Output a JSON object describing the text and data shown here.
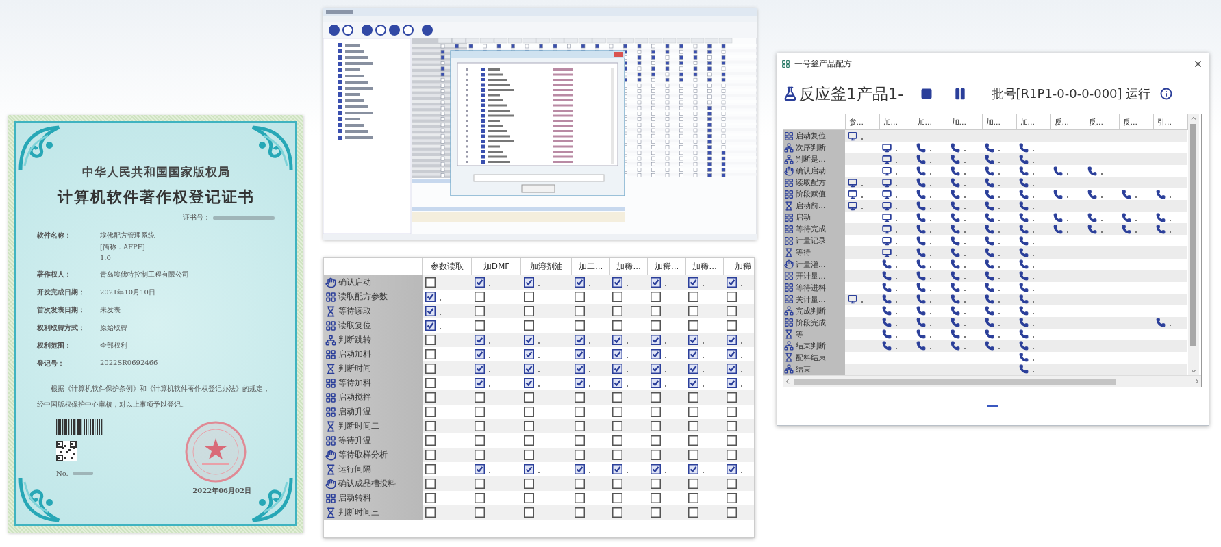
{
  "certificate": {
    "issuer": "中华人民共和国国家版权局",
    "title": "计算机软件著作权登记证书",
    "certificate_no_label": "证书号：",
    "fields": [
      {
        "label": "软件名称：",
        "lines": [
          "埃佛配方管理系统",
          "[简称：AFPF]",
          "1.0"
        ]
      },
      {
        "label": "著作权人：",
        "lines": [
          "青岛埃佛特控制工程有限公司"
        ]
      },
      {
        "label": "开发完成日期：",
        "lines": [
          "2021年10月10日"
        ]
      },
      {
        "label": "首次发表日期：",
        "lines": [
          "未发表"
        ]
      },
      {
        "label": "权利取得方式：",
        "lines": [
          "原始取得"
        ]
      },
      {
        "label": "权利范围：",
        "lines": [
          "全部权利"
        ]
      },
      {
        "label": "登记号：",
        "lines": [
          "2022SR0692466"
        ]
      }
    ],
    "statement": "根据《计算机软件保护条例》和《计算机软件著作权登记办法》的规定，经中国版权保护中心审核，对以上事项予以登记。",
    "serial_label": "No.",
    "date": "2022年06月02日"
  },
  "step_table": {
    "columns": [
      "参数读取",
      "加DMF",
      "加溶剂油",
      "加二...",
      "加稀...",
      "加稀...",
      "加稀...",
      "加稀"
    ],
    "rows": [
      {
        "label": "确认启动",
        "kind": "confirm",
        "cells": [
          {
            "checked": false
          },
          {
            "checked": true
          },
          {
            "checked": true
          },
          {
            "checked": true
          },
          {
            "checked": true
          },
          {
            "checked": true
          },
          {
            "checked": true
          },
          {
            "checked": true
          }
        ]
      },
      {
        "label": "读取配方参数",
        "kind": "action",
        "cells": [
          {
            "checked": true
          },
          {
            "checked": false
          },
          {
            "checked": false
          },
          {
            "checked": false
          },
          {
            "checked": false
          },
          {
            "checked": false
          },
          {
            "checked": false
          },
          {
            "checked": false
          }
        ]
      },
      {
        "label": "等待读取",
        "kind": "wait",
        "cells": [
          {
            "checked": true
          },
          {
            "checked": false
          },
          {
            "checked": false
          },
          {
            "checked": false
          },
          {
            "checked": false
          },
          {
            "checked": false
          },
          {
            "checked": false
          },
          {
            "checked": false
          }
        ]
      },
      {
        "label": "读取复位",
        "kind": "action",
        "cells": [
          {
            "checked": true
          },
          {
            "checked": false
          },
          {
            "checked": false
          },
          {
            "checked": false
          },
          {
            "checked": false
          },
          {
            "checked": false
          },
          {
            "checked": false
          },
          {
            "checked": false
          }
        ]
      },
      {
        "label": "判断跳转",
        "kind": "branch",
        "cells": [
          {
            "checked": false
          },
          {
            "checked": true
          },
          {
            "checked": true
          },
          {
            "checked": true
          },
          {
            "checked": true
          },
          {
            "checked": true
          },
          {
            "checked": true
          },
          {
            "checked": true
          }
        ]
      },
      {
        "label": "启动加料",
        "kind": "action",
        "cells": [
          {
            "checked": false
          },
          {
            "checked": true
          },
          {
            "checked": true
          },
          {
            "checked": true
          },
          {
            "checked": true
          },
          {
            "checked": true
          },
          {
            "checked": true
          },
          {
            "checked": true
          }
        ]
      },
      {
        "label": "判断时间",
        "kind": "wait",
        "cells": [
          {
            "checked": false
          },
          {
            "checked": true
          },
          {
            "checked": true
          },
          {
            "checked": true
          },
          {
            "checked": true
          },
          {
            "checked": true
          },
          {
            "checked": true
          },
          {
            "checked": true
          }
        ]
      },
      {
        "label": "等待加料",
        "kind": "action",
        "cells": [
          {
            "checked": false
          },
          {
            "checked": true
          },
          {
            "checked": true
          },
          {
            "checked": true
          },
          {
            "checked": true
          },
          {
            "checked": true
          },
          {
            "checked": true
          },
          {
            "checked": true
          }
        ]
      },
      {
        "label": "启动搅拌",
        "kind": "action",
        "cells": [
          {
            "checked": false
          },
          {
            "checked": false
          },
          {
            "checked": false
          },
          {
            "checked": false
          },
          {
            "checked": false
          },
          {
            "checked": false
          },
          {
            "checked": false
          },
          {
            "checked": false
          }
        ]
      },
      {
        "label": "启动升温",
        "kind": "action",
        "cells": [
          {
            "checked": false
          },
          {
            "checked": false
          },
          {
            "checked": false
          },
          {
            "checked": false
          },
          {
            "checked": false
          },
          {
            "checked": false
          },
          {
            "checked": false
          },
          {
            "checked": false
          }
        ]
      },
      {
        "label": "判断时间二",
        "kind": "wait",
        "cells": [
          {
            "checked": false
          },
          {
            "checked": false
          },
          {
            "checked": false
          },
          {
            "checked": false
          },
          {
            "checked": false
          },
          {
            "checked": false
          },
          {
            "checked": false
          },
          {
            "checked": false
          }
        ]
      },
      {
        "label": "等待升温",
        "kind": "action",
        "cells": [
          {
            "checked": false
          },
          {
            "checked": false
          },
          {
            "checked": false
          },
          {
            "checked": false
          },
          {
            "checked": false
          },
          {
            "checked": false
          },
          {
            "checked": false
          },
          {
            "checked": false
          }
        ]
      },
      {
        "label": "等待取样分析",
        "kind": "confirm",
        "cells": [
          {
            "checked": false
          },
          {
            "checked": false
          },
          {
            "checked": false
          },
          {
            "checked": false
          },
          {
            "checked": false
          },
          {
            "checked": false
          },
          {
            "checked": false
          },
          {
            "checked": false
          }
        ]
      },
      {
        "label": "运行间隔",
        "kind": "wait",
        "cells": [
          {
            "checked": false
          },
          {
            "checked": true
          },
          {
            "checked": true
          },
          {
            "checked": true
          },
          {
            "checked": true
          },
          {
            "checked": true
          },
          {
            "checked": true
          },
          {
            "checked": true
          }
        ]
      },
      {
        "label": "确认成品槽投料",
        "kind": "confirm",
        "cells": [
          {
            "checked": false
          },
          {
            "checked": false
          },
          {
            "checked": false
          },
          {
            "checked": false
          },
          {
            "checked": false
          },
          {
            "checked": false
          },
          {
            "checked": false
          },
          {
            "checked": false
          }
        ]
      },
      {
        "label": "启动转料",
        "kind": "action",
        "cells": [
          {
            "checked": false
          },
          {
            "checked": false
          },
          {
            "checked": false
          },
          {
            "checked": false
          },
          {
            "checked": false
          },
          {
            "checked": false
          },
          {
            "checked": false
          },
          {
            "checked": false
          }
        ]
      },
      {
        "label": "判断时间三",
        "kind": "wait",
        "cells": [
          {
            "checked": false
          },
          {
            "checked": false
          },
          {
            "checked": false
          },
          {
            "checked": false
          },
          {
            "checked": false
          },
          {
            "checked": false
          },
          {
            "checked": false
          },
          {
            "checked": false
          }
        ]
      }
    ]
  },
  "recipe_window": {
    "title": "一号釜产品配方",
    "heading": "反应釜1产品1-",
    "batch": "批号[R1P1-0-0-0-000] 运行",
    "columns": [
      "参...",
      "加...",
      "加...",
      "加...",
      "加...",
      "加...",
      "反...",
      "反...",
      "反...",
      "引..."
    ],
    "rows": [
      {
        "label": "启动复位",
        "kind": "action",
        "cells": [
          {
            "kind": "display"
          },
          {
            "kind": "empty"
          },
          {
            "kind": "empty"
          },
          {
            "kind": "empty"
          },
          {
            "kind": "empty"
          },
          {
            "kind": "empty"
          },
          {
            "kind": "empty"
          },
          {
            "kind": "empty"
          },
          {
            "kind": "empty"
          },
          {
            "kind": "empty"
          }
        ]
      },
      {
        "label": "次序判断",
        "kind": "branch",
        "cells": [
          {
            "kind": "empty"
          },
          {
            "kind": "display"
          },
          {
            "kind": "phone"
          },
          {
            "kind": "phone"
          },
          {
            "kind": "phone"
          },
          {
            "kind": "phone"
          },
          {
            "kind": "empty"
          },
          {
            "kind": "empty"
          },
          {
            "kind": "empty"
          },
          {
            "kind": "empty"
          }
        ]
      },
      {
        "label": "判断是...",
        "kind": "branch",
        "cells": [
          {
            "kind": "empty"
          },
          {
            "kind": "display"
          },
          {
            "kind": "phone"
          },
          {
            "kind": "phone"
          },
          {
            "kind": "phone"
          },
          {
            "kind": "phone"
          },
          {
            "kind": "empty"
          },
          {
            "kind": "empty"
          },
          {
            "kind": "empty"
          },
          {
            "kind": "empty"
          }
        ]
      },
      {
        "label": "确认启动",
        "kind": "confirm",
        "cells": [
          {
            "kind": "empty"
          },
          {
            "kind": "display"
          },
          {
            "kind": "phone"
          },
          {
            "kind": "phone"
          },
          {
            "kind": "phone"
          },
          {
            "kind": "phone"
          },
          {
            "kind": "phone"
          },
          {
            "kind": "phone"
          },
          {
            "kind": "empty"
          },
          {
            "kind": "empty"
          }
        ]
      },
      {
        "label": "读取配方",
        "kind": "action",
        "cells": [
          {
            "kind": "display"
          },
          {
            "kind": "display"
          },
          {
            "kind": "phone"
          },
          {
            "kind": "phone"
          },
          {
            "kind": "phone"
          },
          {
            "kind": "phone"
          },
          {
            "kind": "empty"
          },
          {
            "kind": "empty"
          },
          {
            "kind": "empty"
          },
          {
            "kind": "empty"
          }
        ]
      },
      {
        "label": "阶段赋值",
        "kind": "action",
        "cells": [
          {
            "kind": "display"
          },
          {
            "kind": "display"
          },
          {
            "kind": "phone"
          },
          {
            "kind": "phone"
          },
          {
            "kind": "phone"
          },
          {
            "kind": "phone"
          },
          {
            "kind": "phone"
          },
          {
            "kind": "phone"
          },
          {
            "kind": "phone"
          },
          {
            "kind": "phone"
          }
        ]
      },
      {
        "label": "启动前...",
        "kind": "wait",
        "cells": [
          {
            "kind": "display"
          },
          {
            "kind": "display"
          },
          {
            "kind": "phone"
          },
          {
            "kind": "phone"
          },
          {
            "kind": "phone"
          },
          {
            "kind": "phone"
          },
          {
            "kind": "empty"
          },
          {
            "kind": "empty"
          },
          {
            "kind": "empty"
          },
          {
            "kind": "empty"
          }
        ]
      },
      {
        "label": "启动",
        "kind": "action",
        "cells": [
          {
            "kind": "empty"
          },
          {
            "kind": "display"
          },
          {
            "kind": "phone"
          },
          {
            "kind": "phone"
          },
          {
            "kind": "phone"
          },
          {
            "kind": "phone"
          },
          {
            "kind": "phone"
          },
          {
            "kind": "phone"
          },
          {
            "kind": "phone"
          },
          {
            "kind": "phone"
          }
        ]
      },
      {
        "label": "等待完成",
        "kind": "action",
        "cells": [
          {
            "kind": "empty"
          },
          {
            "kind": "display"
          },
          {
            "kind": "phone"
          },
          {
            "kind": "phone"
          },
          {
            "kind": "phone"
          },
          {
            "kind": "phone"
          },
          {
            "kind": "phone"
          },
          {
            "kind": "phone"
          },
          {
            "kind": "phone"
          },
          {
            "kind": "phone"
          }
        ]
      },
      {
        "label": "计量记录",
        "kind": "action",
        "cells": [
          {
            "kind": "empty"
          },
          {
            "kind": "display"
          },
          {
            "kind": "phone"
          },
          {
            "kind": "phone"
          },
          {
            "kind": "phone"
          },
          {
            "kind": "phone"
          },
          {
            "kind": "empty"
          },
          {
            "kind": "empty"
          },
          {
            "kind": "empty"
          },
          {
            "kind": "empty"
          }
        ]
      },
      {
        "label": "等待",
        "kind": "wait",
        "cells": [
          {
            "kind": "empty"
          },
          {
            "kind": "display"
          },
          {
            "kind": "phone"
          },
          {
            "kind": "phone"
          },
          {
            "kind": "phone"
          },
          {
            "kind": "phone"
          },
          {
            "kind": "empty"
          },
          {
            "kind": "empty"
          },
          {
            "kind": "empty"
          },
          {
            "kind": "empty"
          }
        ]
      },
      {
        "label": "计量灌...",
        "kind": "confirm",
        "cells": [
          {
            "kind": "empty"
          },
          {
            "kind": "phone"
          },
          {
            "kind": "phone"
          },
          {
            "kind": "phone"
          },
          {
            "kind": "phone"
          },
          {
            "kind": "phone"
          },
          {
            "kind": "empty"
          },
          {
            "kind": "empty"
          },
          {
            "kind": "empty"
          },
          {
            "kind": "empty"
          }
        ]
      },
      {
        "label": "开计量...",
        "kind": "action",
        "cells": [
          {
            "kind": "empty"
          },
          {
            "kind": "phone"
          },
          {
            "kind": "phone"
          },
          {
            "kind": "phone"
          },
          {
            "kind": "phone"
          },
          {
            "kind": "phone"
          },
          {
            "kind": "empty"
          },
          {
            "kind": "empty"
          },
          {
            "kind": "empty"
          },
          {
            "kind": "empty"
          }
        ]
      },
      {
        "label": "等待进料",
        "kind": "action",
        "cells": [
          {
            "kind": "empty"
          },
          {
            "kind": "phone"
          },
          {
            "kind": "phone"
          },
          {
            "kind": "phone"
          },
          {
            "kind": "phone"
          },
          {
            "kind": "phone"
          },
          {
            "kind": "empty"
          },
          {
            "kind": "empty"
          },
          {
            "kind": "empty"
          },
          {
            "kind": "empty"
          }
        ]
      },
      {
        "label": "关计量...",
        "kind": "action",
        "cells": [
          {
            "kind": "display"
          },
          {
            "kind": "phone"
          },
          {
            "kind": "phone"
          },
          {
            "kind": "phone"
          },
          {
            "kind": "phone"
          },
          {
            "kind": "phone"
          },
          {
            "kind": "empty"
          },
          {
            "kind": "empty"
          },
          {
            "kind": "empty"
          },
          {
            "kind": "empty"
          }
        ]
      },
      {
        "label": "完成判断",
        "kind": "branch",
        "cells": [
          {
            "kind": "empty"
          },
          {
            "kind": "phone"
          },
          {
            "kind": "phone"
          },
          {
            "kind": "phone"
          },
          {
            "kind": "phone"
          },
          {
            "kind": "phone"
          },
          {
            "kind": "empty"
          },
          {
            "kind": "empty"
          },
          {
            "kind": "empty"
          },
          {
            "kind": "empty"
          }
        ]
      },
      {
        "label": "阶段完成",
        "kind": "action",
        "cells": [
          {
            "kind": "empty"
          },
          {
            "kind": "phone"
          },
          {
            "kind": "phone"
          },
          {
            "kind": "phone"
          },
          {
            "kind": "phone"
          },
          {
            "kind": "phone"
          },
          {
            "kind": "empty"
          },
          {
            "kind": "empty"
          },
          {
            "kind": "empty"
          },
          {
            "kind": "phone"
          }
        ]
      },
      {
        "label": "等",
        "kind": "wait",
        "cells": [
          {
            "kind": "empty"
          },
          {
            "kind": "phone"
          },
          {
            "kind": "phone"
          },
          {
            "kind": "phone"
          },
          {
            "kind": "phone"
          },
          {
            "kind": "phone"
          },
          {
            "kind": "empty"
          },
          {
            "kind": "empty"
          },
          {
            "kind": "empty"
          },
          {
            "kind": "empty"
          }
        ]
      },
      {
        "label": "结束判断",
        "kind": "branch",
        "cells": [
          {
            "kind": "empty"
          },
          {
            "kind": "phone"
          },
          {
            "kind": "phone"
          },
          {
            "kind": "phone"
          },
          {
            "kind": "phone"
          },
          {
            "kind": "phone"
          },
          {
            "kind": "empty"
          },
          {
            "kind": "empty"
          },
          {
            "kind": "empty"
          },
          {
            "kind": "empty"
          }
        ]
      },
      {
        "label": "配料结束",
        "kind": "wait",
        "cells": [
          {
            "kind": "empty"
          },
          {
            "kind": "empty"
          },
          {
            "kind": "empty"
          },
          {
            "kind": "empty"
          },
          {
            "kind": "empty"
          },
          {
            "kind": "phone"
          },
          {
            "kind": "empty"
          },
          {
            "kind": "empty"
          },
          {
            "kind": "empty"
          },
          {
            "kind": "empty"
          }
        ]
      },
      {
        "label": "结束",
        "kind": "branch",
        "cells": [
          {
            "kind": "empty"
          },
          {
            "kind": "empty"
          },
          {
            "kind": "empty"
          },
          {
            "kind": "empty"
          },
          {
            "kind": "empty"
          },
          {
            "kind": "phone"
          },
          {
            "kind": "empty"
          },
          {
            "kind": "empty"
          },
          {
            "kind": "empty"
          },
          {
            "kind": "empty"
          }
        ]
      }
    ]
  }
}
